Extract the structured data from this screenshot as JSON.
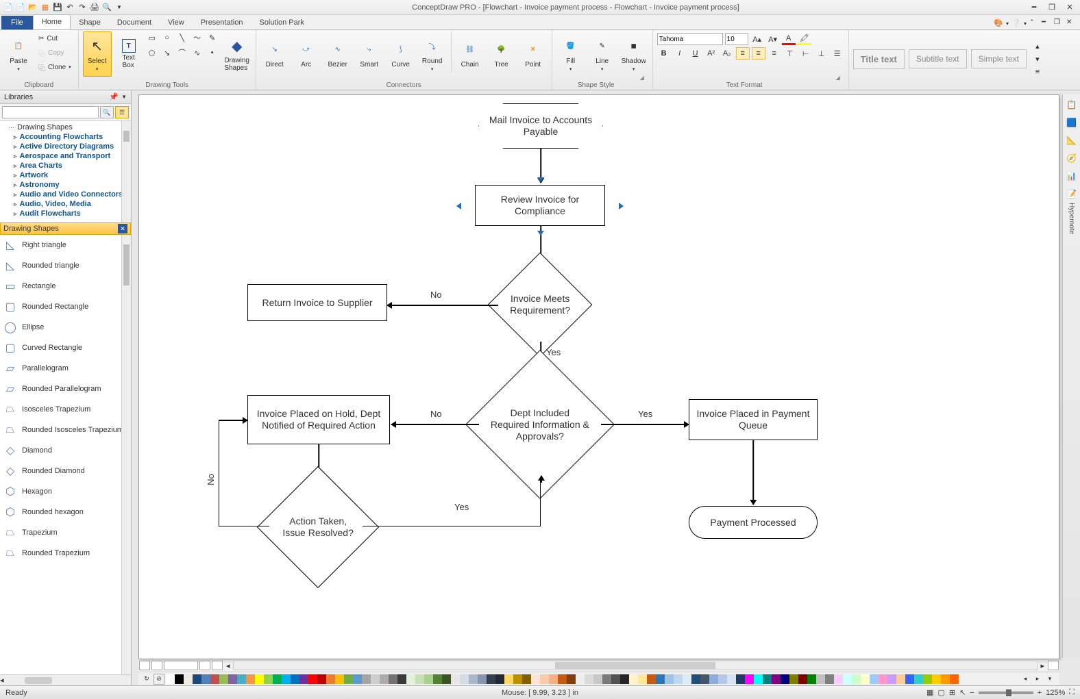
{
  "title": "ConceptDraw PRO - [Flowchart - Invoice payment process - Flowchart - Invoice payment process]",
  "tabs": {
    "file": "File",
    "items": [
      "Home",
      "Shape",
      "Document",
      "View",
      "Presentation",
      "Solution Park"
    ],
    "active": 0
  },
  "ribbon": {
    "clipboard": {
      "paste": "Paste",
      "cut": "Cut",
      "copy": "Copy",
      "clone": "Clone",
      "label": "Clipboard"
    },
    "drawing": {
      "select": "Select",
      "textbox": "Text\nBox",
      "drawshapes": "Drawing\nShapes",
      "label": "Drawing Tools"
    },
    "connectors": {
      "direct": "Direct",
      "arc": "Arc",
      "bezier": "Bezier",
      "smart": "Smart",
      "curve": "Curve",
      "round": "Round",
      "chain": "Chain",
      "tree": "Tree",
      "point": "Point",
      "label": "Connectors"
    },
    "shapestyle": {
      "fill": "Fill",
      "line": "Line",
      "shadow": "Shadow",
      "label": "Shape Style"
    },
    "textformat": {
      "font": "Tahoma",
      "size": "10",
      "label": "Text Format"
    },
    "textstyles": {
      "title": "Title text",
      "subtitle": "Subtitle text",
      "simple": "Simple text"
    }
  },
  "libraries": {
    "header": "Libraries",
    "tree_root": "Drawing Shapes",
    "tree": [
      "Accounting Flowcharts",
      "Active Directory Diagrams",
      "Aerospace and Transport",
      "Area Charts",
      "Artwork",
      "Astronomy",
      "Audio and Video Connectors",
      "Audio, Video, Media",
      "Audit Flowcharts"
    ],
    "shapes_hdr": "Drawing Shapes",
    "shapes": [
      "Right triangle",
      "Rounded triangle",
      "Rectangle",
      "Rounded Rectangle",
      "Ellipse",
      "Curved Rectangle",
      "Parallelogram",
      "Rounded Parallelogram",
      "Isosceles Trapezium",
      "Rounded Isosceles Trapezium",
      "Diamond",
      "Rounded Diamond",
      "Hexagon",
      "Rounded hexagon",
      "Trapezium",
      "Rounded Trapezium"
    ]
  },
  "flowchart": {
    "n1": "Mail Invoice to Accounts Payable",
    "n2": "Review Invoice for Compliance",
    "n3": "Invoice Meets Requirement?",
    "n4": "Return Invoice to Supplier",
    "n5": "Dept Included Required Information & Approvals?",
    "n6": "Invoice Placed on Hold, Dept Notified of Required Action",
    "n7": "Invoice Placed in Payment Queue",
    "n8": "Action Taken, Issue Resolved?",
    "n9": "Payment Processed",
    "yes": "Yes",
    "no": "No"
  },
  "status": {
    "ready": "Ready",
    "mouse": "Mouse: [ 9.99, 3.23 ] in",
    "zoom": "125%"
  },
  "right_strip": {
    "hypernote": "Hypernote"
  },
  "palette": [
    "#ffffff",
    "#000000",
    "#eeece1",
    "#1f497d",
    "#4f81bd",
    "#c0504d",
    "#9bbb59",
    "#8064a2",
    "#4bacc6",
    "#f79646",
    "#ffff00",
    "#92d050",
    "#00b050",
    "#00b0f0",
    "#0070c0",
    "#7030a0",
    "#ff0000",
    "#c00000",
    "#ed7d31",
    "#ffc000",
    "#70ad47",
    "#5b9bd5",
    "#a5a5a5",
    "#d0cece",
    "#afabab",
    "#767171",
    "#3b3838",
    "#e2efda",
    "#c6e0b4",
    "#a9d08e",
    "#548235",
    "#375623",
    "#e7e6e6",
    "#d6dce4",
    "#acb9ca",
    "#8497b0",
    "#333f4f",
    "#222b35",
    "#ffd966",
    "#bf8f00",
    "#806000",
    "#fce4d6",
    "#f8cbad",
    "#f4b084",
    "#c65911",
    "#833c0c",
    "#ededed",
    "#dbdbdb",
    "#c9c9c9",
    "#7b7b7b",
    "#525252",
    "#262626",
    "#fff2cc",
    "#ffe699",
    "#c55a11",
    "#2e75b6",
    "#9dc3e6",
    "#bdd7ee",
    "#ddebf7",
    "#1f4e78",
    "#44546a",
    "#8faadc",
    "#b4c7e7",
    "#dae3f3",
    "#203864",
    "#ff00ff",
    "#00ffff",
    "#008080",
    "#800080",
    "#000080",
    "#808000",
    "#800000",
    "#008000",
    "#c0c0c0",
    "#808080",
    "#ffccff",
    "#ccffff",
    "#ccffcc",
    "#ffffcc",
    "#99ccff",
    "#ff99cc",
    "#cc99ff",
    "#ffcc99",
    "#3366ff",
    "#33cccc",
    "#99cc00",
    "#ffcc00",
    "#ff9900",
    "#ff6600"
  ]
}
